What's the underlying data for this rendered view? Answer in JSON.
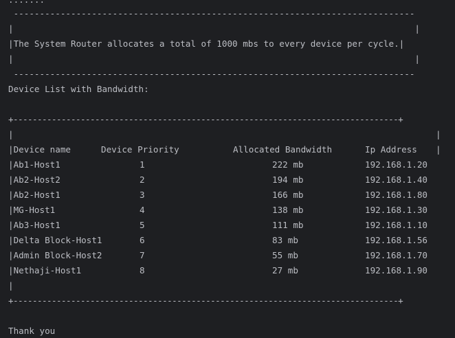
{
  "terminal": {
    "top_fragment": ".......",
    "notice": {
      "border": " -----------------------------------------------------------------------------",
      "empty_line": "|                                                                             |",
      "message": "|The System Router allocates a total of 1000 mbs to every device per cycle.|"
    },
    "list_title": "Device List with Bandwidth:",
    "table": {
      "border": "+--------------------------------------------------------------------------------+",
      "empty_line_left": "|",
      "empty_line_right": "|",
      "headers": {
        "name": "|Device name",
        "priority": "Device Priority",
        "bandwidth": "Allocated Bandwidth",
        "ip": "Ip Address"
      },
      "rows": [
        {
          "name": "|Ab1-Host1",
          "priority": "1",
          "bandwidth": "222 mb",
          "ip": "192.168.1.20"
        },
        {
          "name": "|Ab2-Host2",
          "priority": "2",
          "bandwidth": "194 mb",
          "ip": "192.168.1.40"
        },
        {
          "name": "|Ab2-Host1",
          "priority": "3",
          "bandwidth": "166 mb",
          "ip": "192.168.1.80"
        },
        {
          "name": "|MG-Host1",
          "priority": "4",
          "bandwidth": "138 mb",
          "ip": "192.168.1.30"
        },
        {
          "name": "|Ab3-Host1",
          "priority": "5",
          "bandwidth": "111 mb",
          "ip": "192.168.1.10"
        },
        {
          "name": "|Delta Block-Host1",
          "priority": "6",
          "bandwidth": "83 mb",
          "ip": "192.168.1.56"
        },
        {
          "name": "|Admin Block-Host2",
          "priority": "7",
          "bandwidth": "55 mb",
          "ip": "192.168.1.70"
        },
        {
          "name": "|Nethaji-Host1",
          "priority": "8",
          "bandwidth": "27 mb",
          "ip": "192.168.1.90"
        }
      ]
    },
    "closing": "Thank you",
    "colors": {
      "background": "#1e1f22",
      "text": "#bcbec4"
    }
  }
}
